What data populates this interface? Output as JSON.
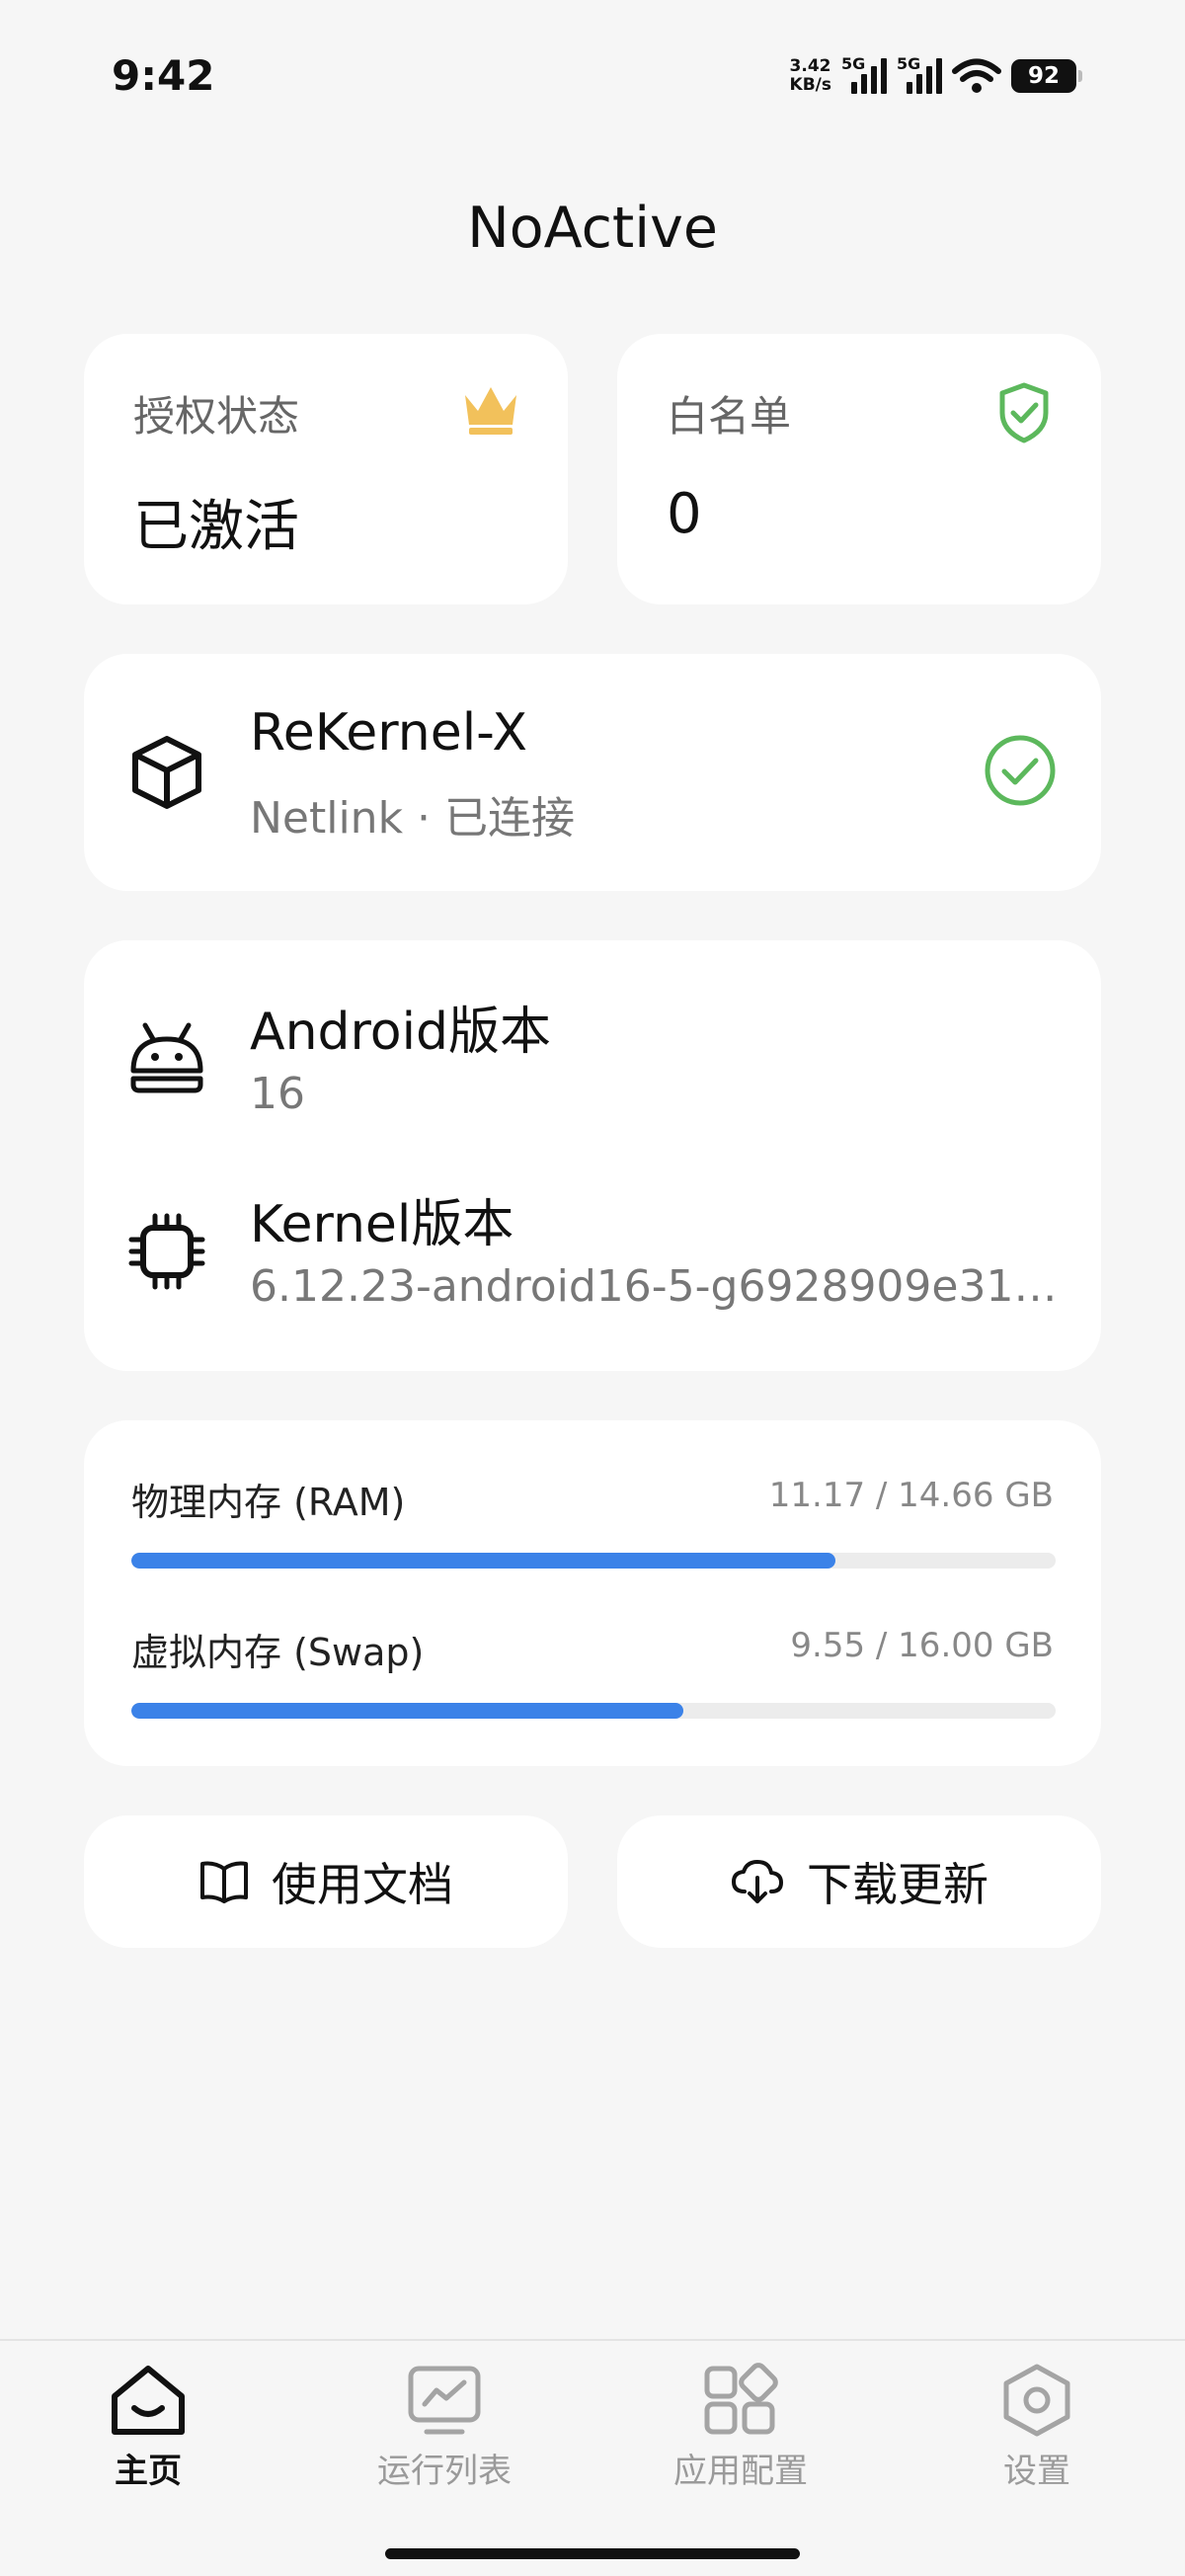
{
  "status_bar": {
    "time": "9:42",
    "net_speed_value": "3.42",
    "net_speed_unit": "KB/s",
    "signal1_label": "5G",
    "signal2_label": "5G",
    "battery": "92"
  },
  "app_title": "NoActive",
  "auth_card": {
    "label": "授权状态",
    "value": "已激活",
    "icon": "crown-icon"
  },
  "whitelist_card": {
    "label": "白名单",
    "value": "0",
    "icon": "shield-check-icon"
  },
  "rekernel_card": {
    "title": "ReKernel-X",
    "subtitle": "Netlink · 已连接",
    "icon": "cube-icon",
    "status_icon": "check-circle-icon",
    "accent": "#5cb85c"
  },
  "version_card": {
    "android_title": "Android版本",
    "android_value": "16",
    "kernel_title": "Kernel版本",
    "kernel_value": "6.12.23-android16-5-g6928909e31…"
  },
  "memory_card": {
    "ram_label": "物理内存 (RAM)",
    "ram_value": "11.17 / 14.66 GB",
    "ram_fraction": 0.762,
    "swap_label": "虚拟内存 (Swap)",
    "swap_value": "9.55 / 16.00 GB",
    "swap_fraction": 0.597,
    "bar_color": "#3b82e8"
  },
  "buttons": {
    "docs_label": "使用文档",
    "update_label": "下载更新"
  },
  "bottom_nav": {
    "items": [
      {
        "label": "主页",
        "icon": "home-icon",
        "active": true
      },
      {
        "label": "运行列表",
        "icon": "monitor-icon",
        "active": false
      },
      {
        "label": "应用配置",
        "icon": "apps-grid-icon",
        "active": false
      },
      {
        "label": "设置",
        "icon": "settings-hexagon-icon",
        "active": false
      }
    ]
  }
}
